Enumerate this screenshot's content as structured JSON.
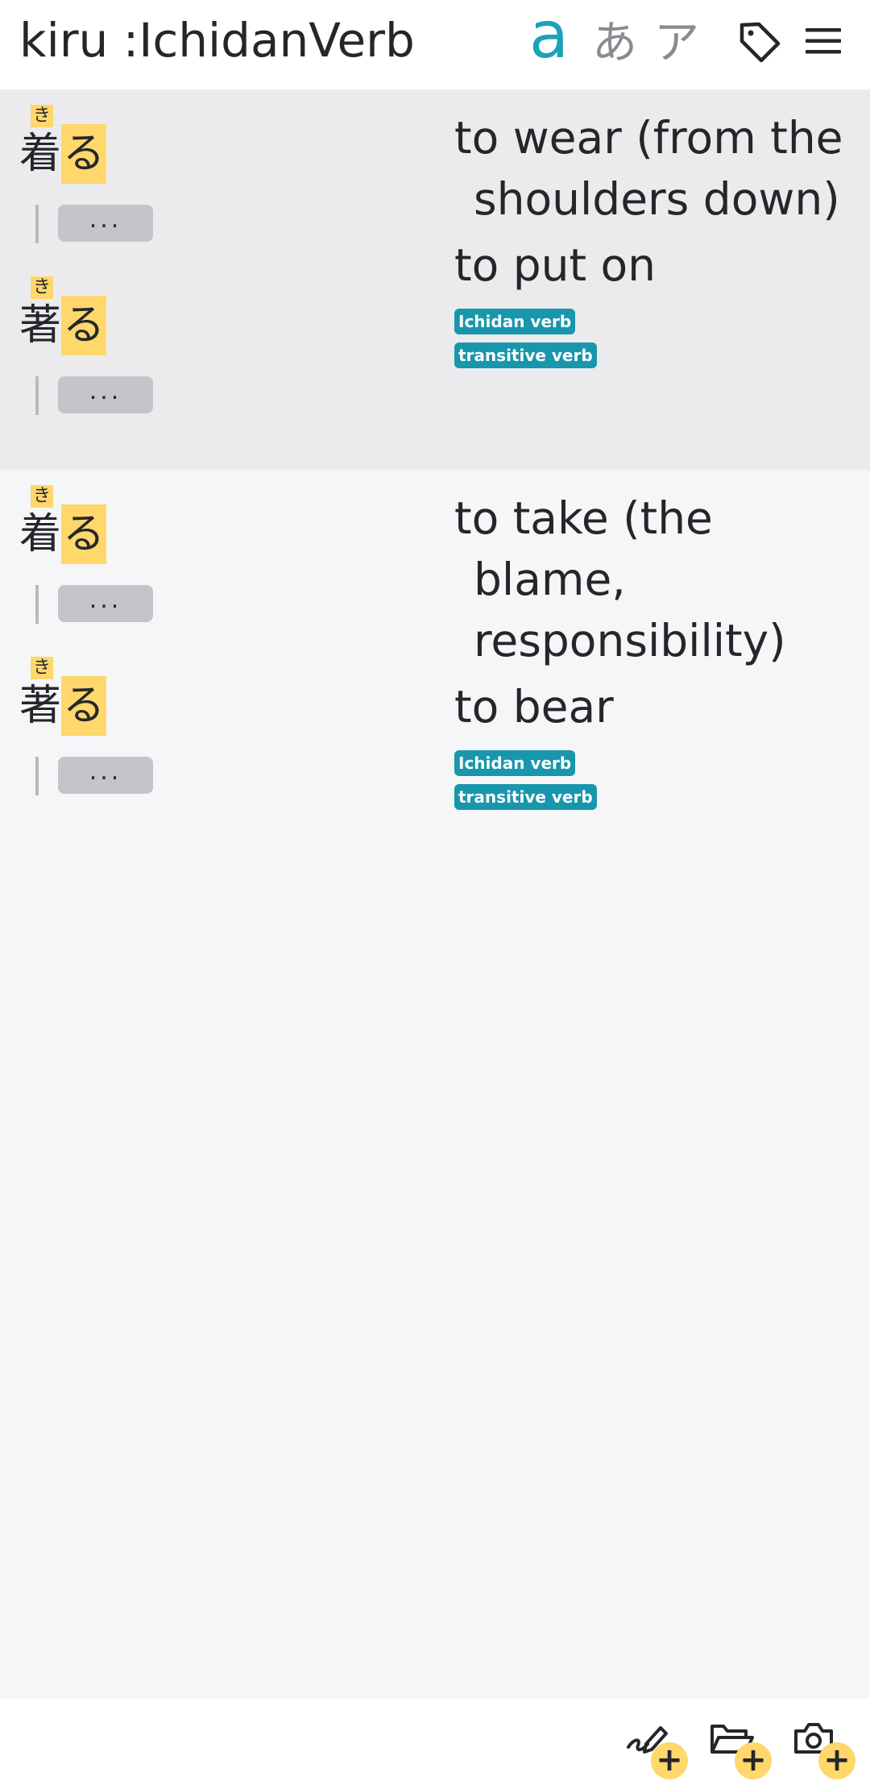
{
  "header": {
    "title": "kiru :IchidanVerb",
    "modes": {
      "romaji": "a",
      "hiragana": "あ",
      "katakana": "ア"
    },
    "accent_color": "#1aa2b8",
    "icons": [
      "tag-icon",
      "menu-icon"
    ]
  },
  "entries": [
    {
      "forms": [
        {
          "kanji": "着",
          "furigana": "き",
          "okurigana": "る",
          "more": "..."
        },
        {
          "kanji": "著",
          "furigana": "き",
          "okurigana": "る",
          "more": "..."
        }
      ],
      "meanings": [
        "to wear (from the shoulders down)",
        "to put on"
      ],
      "tags": [
        "Ichidan verb",
        "transitive verb"
      ]
    },
    {
      "forms": [
        {
          "kanji": "着",
          "furigana": "き",
          "okurigana": "る",
          "more": "..."
        },
        {
          "kanji": "著",
          "furigana": "き",
          "okurigana": "る",
          "more": "..."
        }
      ],
      "meanings": [
        "to take (the blame, responsibility)",
        "to bear"
      ],
      "tags": [
        "Ichidan verb",
        "transitive verb"
      ]
    }
  ],
  "footer": {
    "icons": [
      "add-drawing-icon",
      "add-folder-icon",
      "add-photo-icon"
    ],
    "plus": "+"
  },
  "colors": {
    "highlight": "#ffd76a",
    "tag_bg": "#1896ac",
    "entry_bg_alt": "#ebebed"
  }
}
